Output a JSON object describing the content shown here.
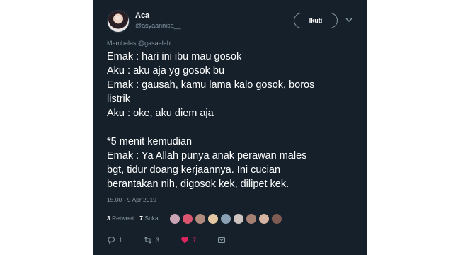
{
  "user": {
    "name": "Aca",
    "handle": "@asyaannisa__"
  },
  "follow_label": "Ikuti",
  "reply": {
    "prefix": "Membalas",
    "mention": "@gasaelah"
  },
  "tweet_lines": [
    "Emak : hari ini ibu mau gosok",
    "Aku : aku aja yg gosok bu",
    "Emak : gausah, kamu lama kalo gosok, boros",
    "listrik",
    "Aku : oke, aku diem aja",
    "",
    "*5 menit kemudian",
    "Emak : Ya Allah punya anak perawan males",
    "bgt, tidur doang kerjaannya. Ini cucian",
    "berantakan nih, digosok kek, dilipet kek."
  ],
  "timestamp": "15.00 - 9 Apr 2019",
  "stats": {
    "retweets_count": "3",
    "retweets_label": "Retweet",
    "likes_count": "7",
    "likes_label": "Suka"
  },
  "liker_avatar_colors": [
    "#c7a3b4",
    "#d9566e",
    "#b08a7c",
    "#e3c7a2",
    "#8aa0b5",
    "#cfc3c0",
    "#a67f73",
    "#d6b3a0",
    "#7e5a52"
  ],
  "actions": {
    "reply_count": "1",
    "retweet_count": "3",
    "like_count": "7"
  },
  "colors": {
    "background": "#15202b",
    "secondary_text": "#8899a6",
    "like": "#e0245e"
  }
}
